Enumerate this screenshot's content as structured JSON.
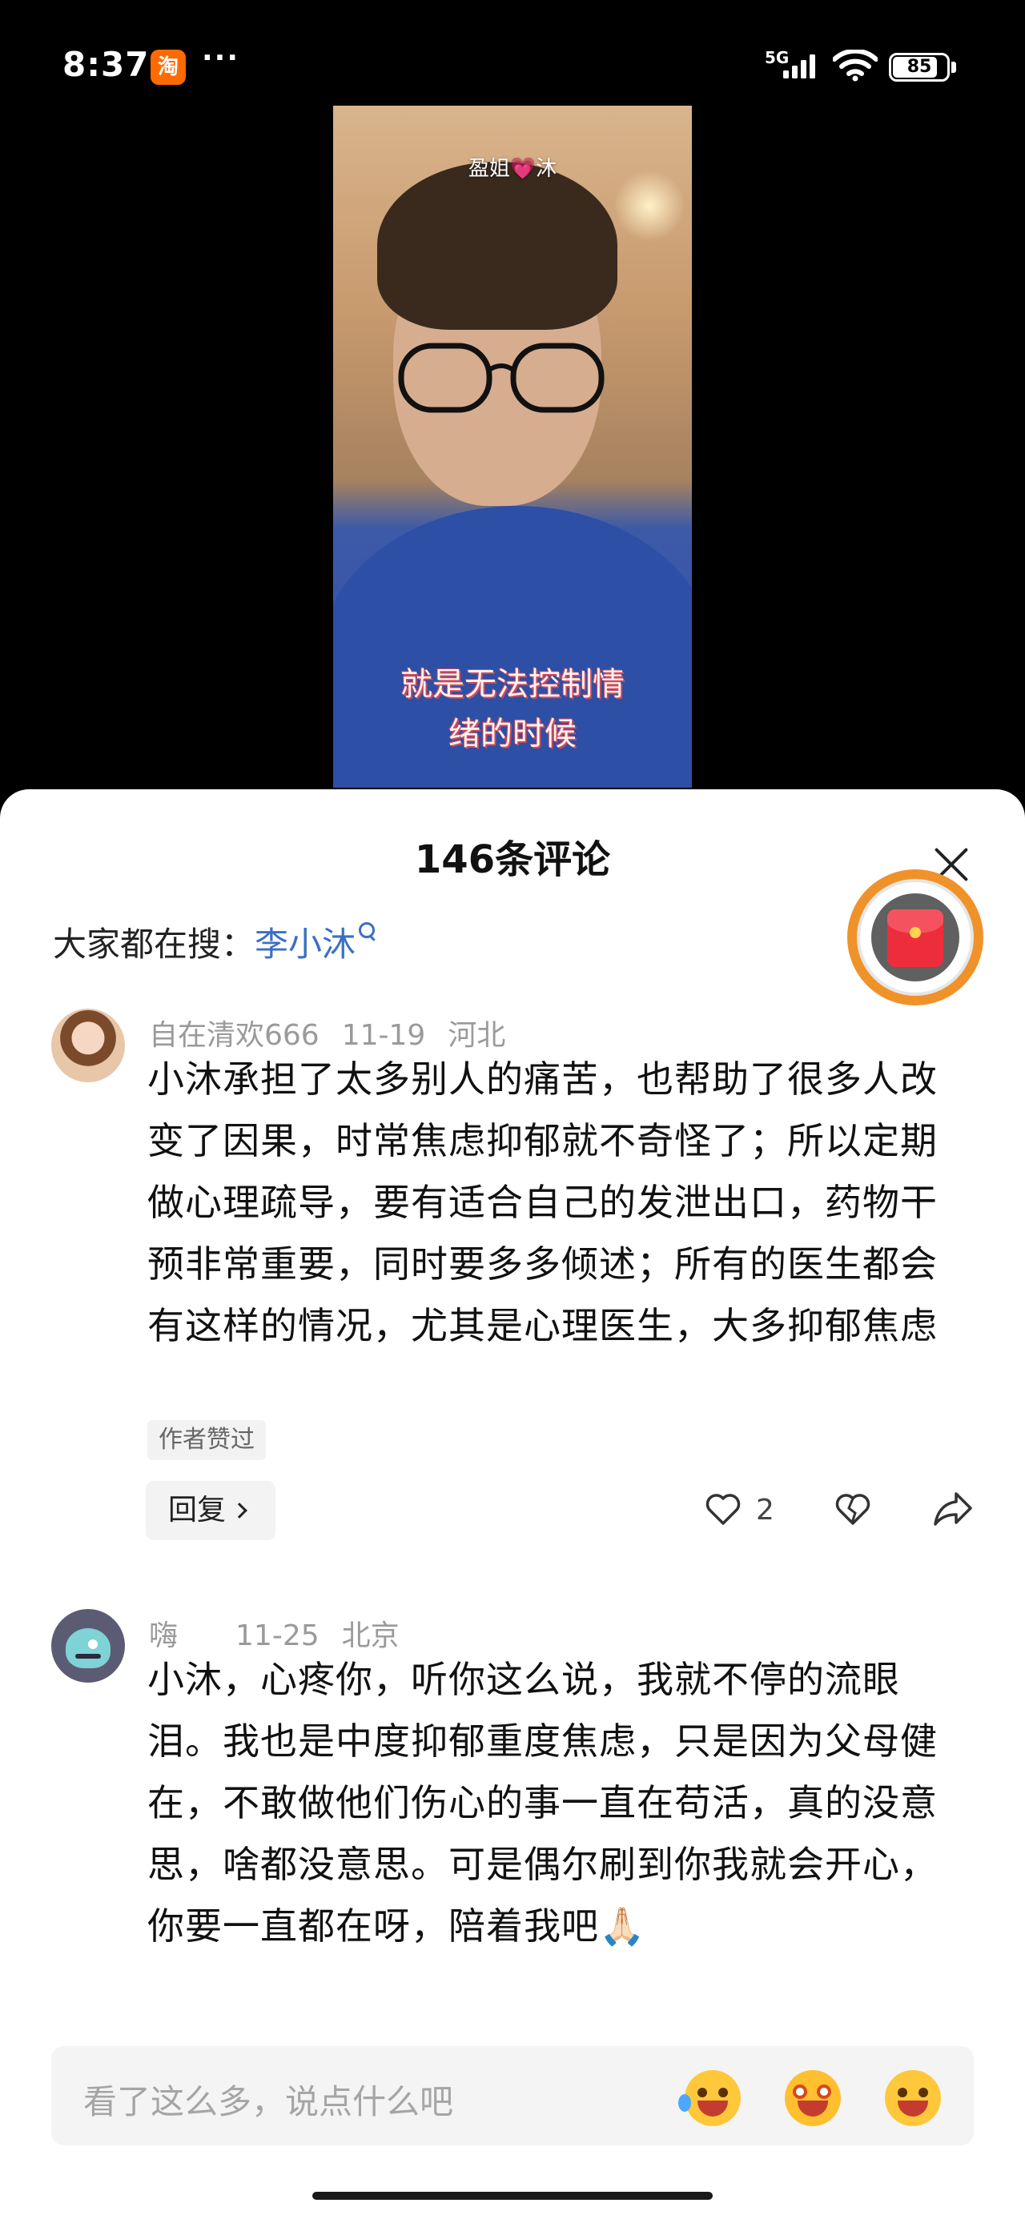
{
  "status_bar": {
    "time": "8:37",
    "app_badge": "淘",
    "more": "···",
    "network": "5G",
    "battery": "85"
  },
  "video": {
    "brand_text": "盈姐💗沐",
    "caption_line1": "就是无法控制情",
    "caption_line2": "绪的时候"
  },
  "comments_panel": {
    "title": "146条评论",
    "search_label": "大家都在搜：",
    "search_term": "李小沐"
  },
  "comments": [
    {
      "username": "自在清欢666",
      "date": "11-19",
      "location": "河北",
      "text": "小沐承担了太多别人的痛苦，也帮助了很多人改变了因果，时常焦虑抑郁就不奇怪了；所以定期做心理疏导，要有适合自己的发泄出口，药物干预非常重要，同时要多多倾述；所有的医生都会有这样的情况，尤其是心理医生，大多抑郁焦虑",
      "badge": "作者赞过",
      "reply_label": "回复",
      "like_count": "2"
    },
    {
      "username": "嗨",
      "date": "11-25",
      "location": "北京",
      "text": "小沐，心疼你，听你这么说，我就不停的流眼泪。我也是中度抑郁重度焦虑，只是因为父母健在，不敢做他们伤心的事一直在苟活，真的没意思，啥都没意思。可是偶尔刷到你我就会开心，你要一直都在呀，陪着我吧🙏🏻"
    }
  ],
  "input": {
    "placeholder": "看了这么多，说点什么吧"
  },
  "colors": {
    "link_blue": "#3a6fc6",
    "redpacket_ring": "#f0922a",
    "redpacket_red": "#ee2d3c"
  }
}
